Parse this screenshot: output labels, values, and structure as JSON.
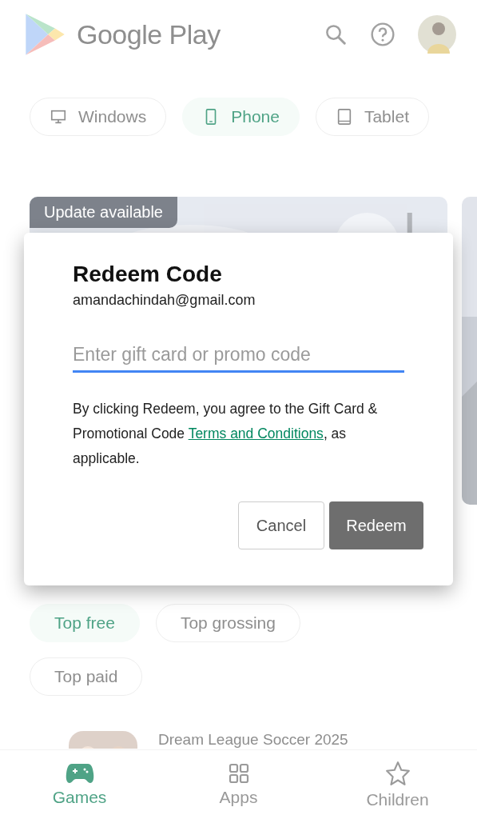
{
  "header": {
    "title": "Google Play"
  },
  "device_tabs": [
    {
      "label": "Windows",
      "selected": false,
      "kind": "desktop"
    },
    {
      "label": "Phone",
      "selected": true,
      "kind": "phone"
    },
    {
      "label": "Tablet",
      "selected": false,
      "kind": "tablet"
    }
  ],
  "featured": {
    "badge": "Update available"
  },
  "dialog": {
    "title": "Redeem Code",
    "account": "amandachindah@gmail.com",
    "code_field": {
      "placeholder": "Enter gift card or promo code"
    },
    "terms": {
      "before": "By clicking Redeem, you agree to the Gift Card & Promotional Code ",
      "link": "Terms and Conditions",
      "after": ", as applicable."
    },
    "buttons": [
      {
        "label": "Cancel",
        "kind": "secondary"
      },
      {
        "label": "Redeem",
        "kind": "primary"
      }
    ]
  },
  "chart_tabs": [
    {
      "label": "Top free",
      "selected": true
    },
    {
      "label": "Top grossing",
      "selected": false
    },
    {
      "label": "Top paid",
      "selected": false
    }
  ],
  "app_list": [
    {
      "name": "Dream League Soccer 2025"
    }
  ],
  "bottom_nav": [
    {
      "label": "Games",
      "selected": true,
      "kind": "games"
    },
    {
      "label": "Apps",
      "selected": false,
      "kind": "apps"
    },
    {
      "label": "Children",
      "selected": false,
      "kind": "children"
    }
  ]
}
